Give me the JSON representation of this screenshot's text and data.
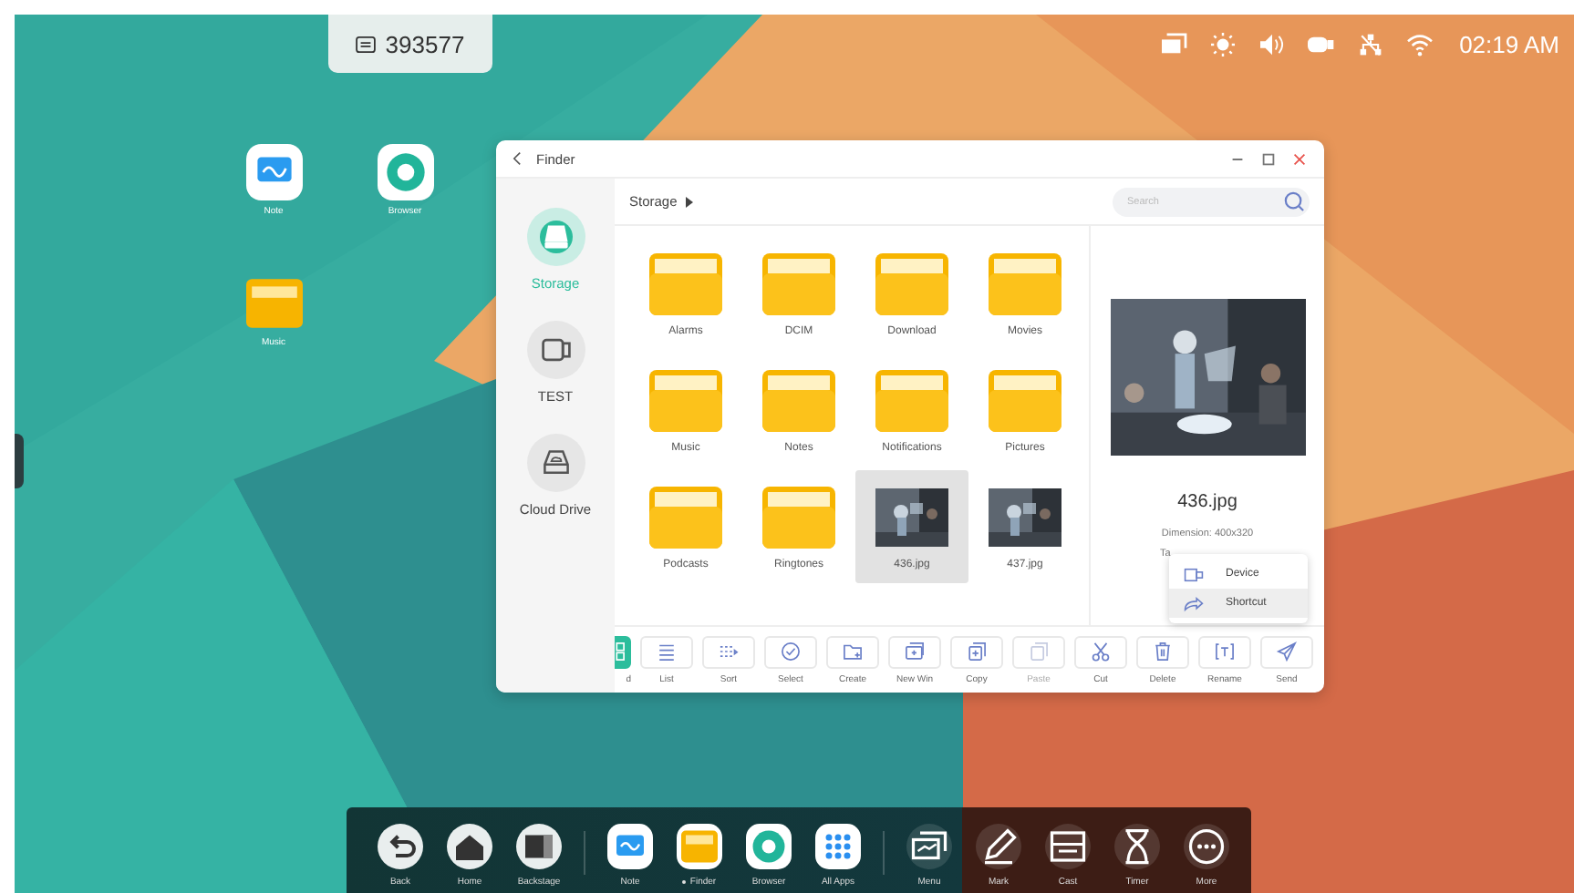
{
  "code_badge": {
    "text": "393577"
  },
  "status_bar": {
    "time": "02:19 AM"
  },
  "desktop_icons": [
    {
      "label": "Note"
    },
    {
      "label": "Browser"
    },
    {
      "label": "Music"
    }
  ],
  "finder": {
    "title": "Finder",
    "sidebar": [
      {
        "label": "Storage",
        "selected": true
      },
      {
        "label": "TEST",
        "selected": false
      },
      {
        "label": "Cloud Drive",
        "selected": false
      }
    ],
    "breadcrumb": "Storage",
    "search": {
      "placeholder": "Search"
    },
    "files": [
      {
        "name": "Alarms",
        "kind": "folder",
        "selected": false
      },
      {
        "name": "DCIM",
        "kind": "folder",
        "selected": false
      },
      {
        "name": "Download",
        "kind": "folder",
        "selected": false
      },
      {
        "name": "Movies",
        "kind": "folder",
        "selected": false
      },
      {
        "name": "Music",
        "kind": "folder",
        "selected": false
      },
      {
        "name": "Notes",
        "kind": "folder",
        "selected": false
      },
      {
        "name": "Notifications",
        "kind": "folder",
        "selected": false
      },
      {
        "name": "Pictures",
        "kind": "folder",
        "selected": false
      },
      {
        "name": "Podcasts",
        "kind": "folder",
        "selected": false
      },
      {
        "name": "Ringtones",
        "kind": "folder",
        "selected": false
      },
      {
        "name": "436.jpg",
        "selected": true
      },
      {
        "name": "437.jpg",
        "selected": false
      }
    ],
    "detail": {
      "name": "436.jpg",
      "dimension": "Dimension: 400x320",
      "line_2": "Ta"
    },
    "popup": [
      {
        "label": "Device",
        "selected": false
      },
      {
        "label": "Shortcut",
        "selected": true
      }
    ],
    "toolbar": [
      {
        "label": "d",
        "selected": true,
        "disabled": false
      },
      {
        "label": "List",
        "selected": false,
        "disabled": false
      },
      {
        "label": "Sort",
        "selected": false,
        "disabled": false
      },
      {
        "label": "Select",
        "selected": false,
        "disabled": false
      },
      {
        "label": "Create",
        "selected": false,
        "disabled": false
      },
      {
        "label": "New Win",
        "selected": false,
        "disabled": false
      },
      {
        "label": "Copy",
        "selected": false,
        "disabled": false
      },
      {
        "label": "Paste",
        "selected": false,
        "disabled": true
      },
      {
        "label": "Cut",
        "selected": false,
        "disabled": false
      },
      {
        "label": "Delete",
        "selected": false,
        "disabled": false
      },
      {
        "label": "Rename",
        "selected": false,
        "disabled": false
      },
      {
        "label": "Send",
        "selected": false,
        "disabled": false
      }
    ]
  },
  "dock": [
    {
      "label": "Back",
      "running": false
    },
    {
      "label": "Home",
      "running": false
    },
    {
      "label": "Backstage",
      "running": false
    },
    {
      "label": "Note",
      "running": false
    },
    {
      "label": "Finder",
      "running": true
    },
    {
      "label": "Browser",
      "running": false
    },
    {
      "label": "All Apps",
      "running": false
    },
    {
      "label": "Menu",
      "running": false
    },
    {
      "label": "Mark",
      "running": false
    },
    {
      "label": "Cast",
      "running": false
    },
    {
      "label": "Timer",
      "running": false
    },
    {
      "label": "More",
      "running": false
    }
  ]
}
